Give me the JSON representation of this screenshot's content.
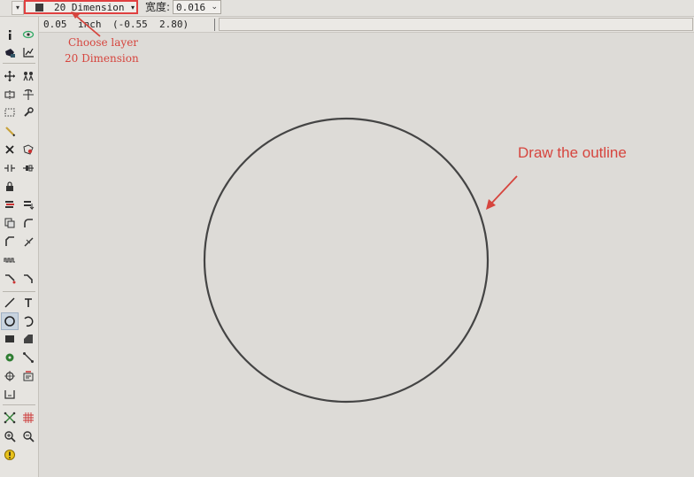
{
  "toolbar": {
    "menu_button": "▾",
    "layer_value": "20 Dimension",
    "width_label": "宽度:",
    "width_value": "0.016",
    "layer_swatch_color": "#3c3c3c",
    "highlight_color": "#e04040"
  },
  "coordinates": {
    "grid": "0.05",
    "unit": "inch",
    "position": "(-0.55  2.80)"
  },
  "sidebar": {
    "tools": [
      "info-icon",
      "eye-icon",
      "mark-icon",
      "plot-icon",
      "move-icon",
      "group-icon",
      "mirror-icon",
      "rotate-icon",
      "select-rect-icon",
      "wrench-icon",
      "pen-icon",
      "delete-icon",
      "paste-icon",
      "split-icon",
      "join-icon",
      "lock-icon",
      "layer-stack-icon",
      "layer-down-icon",
      "copy-icon",
      "fillet-icon",
      "miter-icon",
      "cut-icon",
      "wave-icon",
      "route-icon",
      "ripup-icon",
      "line-icon",
      "text-icon",
      "circle-icon",
      "arc-icon",
      "rectangle-icon",
      "polygon-icon",
      "via-icon",
      "signal-icon",
      "hole-icon",
      "attribute-icon",
      "dimension-icon",
      "ratsnest-icon",
      "grid-icon",
      "zoom-in-icon",
      "zoom-out-icon",
      "drc-icon"
    ]
  },
  "annotations": {
    "choose_layer_line1": "Choose layer",
    "choose_layer_line2": "20 Dimension",
    "draw_outline": "Draw the outline",
    "color": "#d6453e"
  },
  "canvas": {
    "shape": "circle",
    "stroke_color": "#444444"
  }
}
